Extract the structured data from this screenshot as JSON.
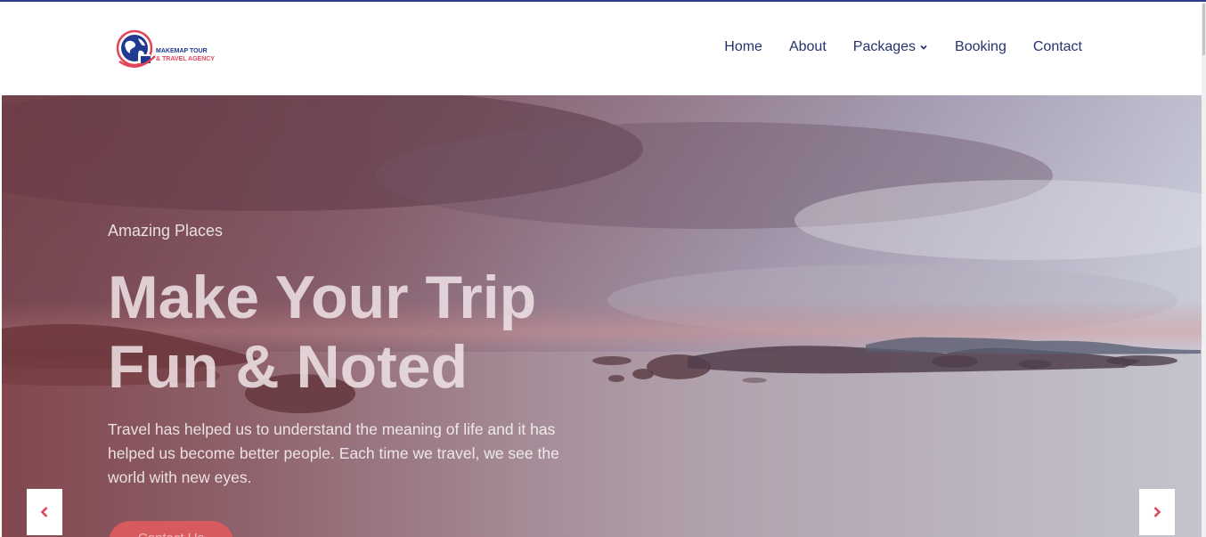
{
  "brand": {
    "line1": "MAKEMAP TOUR",
    "line2": "& TRAVEL AGENCY",
    "primary_color": "#1f3a8f",
    "accent_color": "#e0455a"
  },
  "nav": {
    "home": "Home",
    "about": "About",
    "packages": "Packages",
    "booking": "Booking",
    "contact": "Contact",
    "text_color": "#27336b"
  },
  "hero": {
    "subtitle": "Amazing Places",
    "title_line1": "Make Your Trip",
    "title_line2": "Fun & Noted",
    "description": "Travel has helped us to understand the meaning of life and it has helped us become better people. Each time we travel, we see the world with new eyes.",
    "cta_label": "Contact Us",
    "cta_color": "#d65a5e",
    "prev_icon": "chevron-left-icon",
    "next_icon": "chevron-right-icon",
    "arrow_color": "#e0455a"
  }
}
